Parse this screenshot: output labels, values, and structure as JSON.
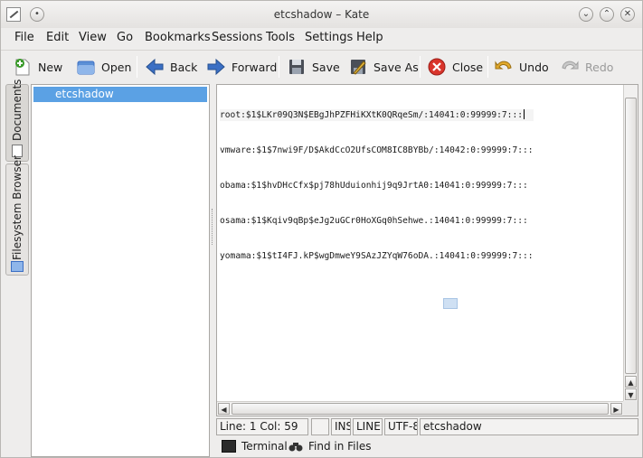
{
  "window": {
    "title": "etcshadow – Kate"
  },
  "menu": [
    "File",
    "Edit",
    "View",
    "Go",
    "Bookmarks",
    "Sessions",
    "Tools",
    "Settings",
    "Help"
  ],
  "toolbar": {
    "new": "New",
    "open": "Open",
    "back": "Back",
    "forward": "Forward",
    "save": "Save",
    "save_as": "Save As",
    "close": "Close",
    "undo": "Undo",
    "redo": "Redo"
  },
  "side_tabs": {
    "documents": "Documents",
    "filesystem": "Filesystem Browser"
  },
  "documents": [
    "etcshadow"
  ],
  "editor": {
    "lines": [
      "root:$1$LKr09Q3N$EBgJhPZFHiKXtK0QRqeSm/:14041:0:99999:7:::",
      "vmware:$1$7nwi9F/D$AkdCcO2UfsCOM8IC8BYBb/:14042:0:99999:7:::",
      "obama:$1$hvDHcCfx$pj78hUduionhij9q9JrtA0:14041:0:99999:7:::",
      "osama:$1$Kqiv9qBp$eJg2uGCr0HoXGq0hSehwe.:14041:0:99999:7:::",
      "yomama:$1$tI4FJ.kP$wgDmweY9SAzJZYqW76oDA.:14041:0:99999:7:::"
    ]
  },
  "status": {
    "position": "Line: 1 Col: 59",
    "mode": "",
    "ins": "INS",
    "line": "LINE",
    "encoding": "UTF-8",
    "filename": "etcshadow"
  },
  "bottom": {
    "terminal": "Terminal",
    "find": "Find in Files"
  },
  "colors": {
    "selection": "#5ba1e4",
    "accent_green": "#3a9a2a",
    "close_red": "#d9342b",
    "arrow_blue": "#3b6fc4"
  }
}
